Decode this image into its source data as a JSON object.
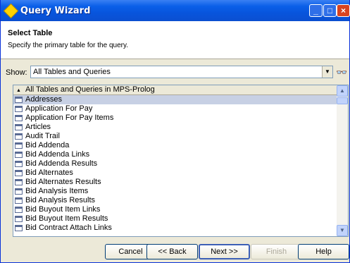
{
  "window": {
    "title": "Query Wizard",
    "minimize": "_",
    "maximize": "□",
    "close": "×"
  },
  "header": {
    "title": "Select Table",
    "subtitle": "Specify the primary table for the query."
  },
  "show": {
    "label": "Show:",
    "value": "All Tables and Queries",
    "dropdown_arrow": "▼",
    "search_icon": "binoculars-icon",
    "search_glyph": "👓"
  },
  "list": {
    "header": "All Tables and Queries in MPS-Prolog",
    "header_arrow": "▲",
    "items": [
      "Addresses",
      "Application For Pay",
      "Application For Pay Items",
      "Articles",
      "Audit Trail",
      "Bid Addenda",
      "Bid Addenda Links",
      "Bid Addenda Results",
      "Bid Alternates",
      "Bid Alternates Results",
      "Bid Analysis Items",
      "Bid Analysis Results",
      "Bid Buyout Item Links",
      "Bid Buyout Item Results",
      "Bid Contract Attach Links"
    ],
    "selected_index": 0,
    "scroll_up": "▲",
    "scroll_down": "▼"
  },
  "buttons": {
    "cancel": "Cancel",
    "back": "<< Back",
    "next": "Next >>",
    "finish": "Finish",
    "help": "Help"
  },
  "colors": {
    "titlebar": "#0a5fe8",
    "selected_row": "#c7d0e4",
    "window_bg": "#ece9d8"
  }
}
